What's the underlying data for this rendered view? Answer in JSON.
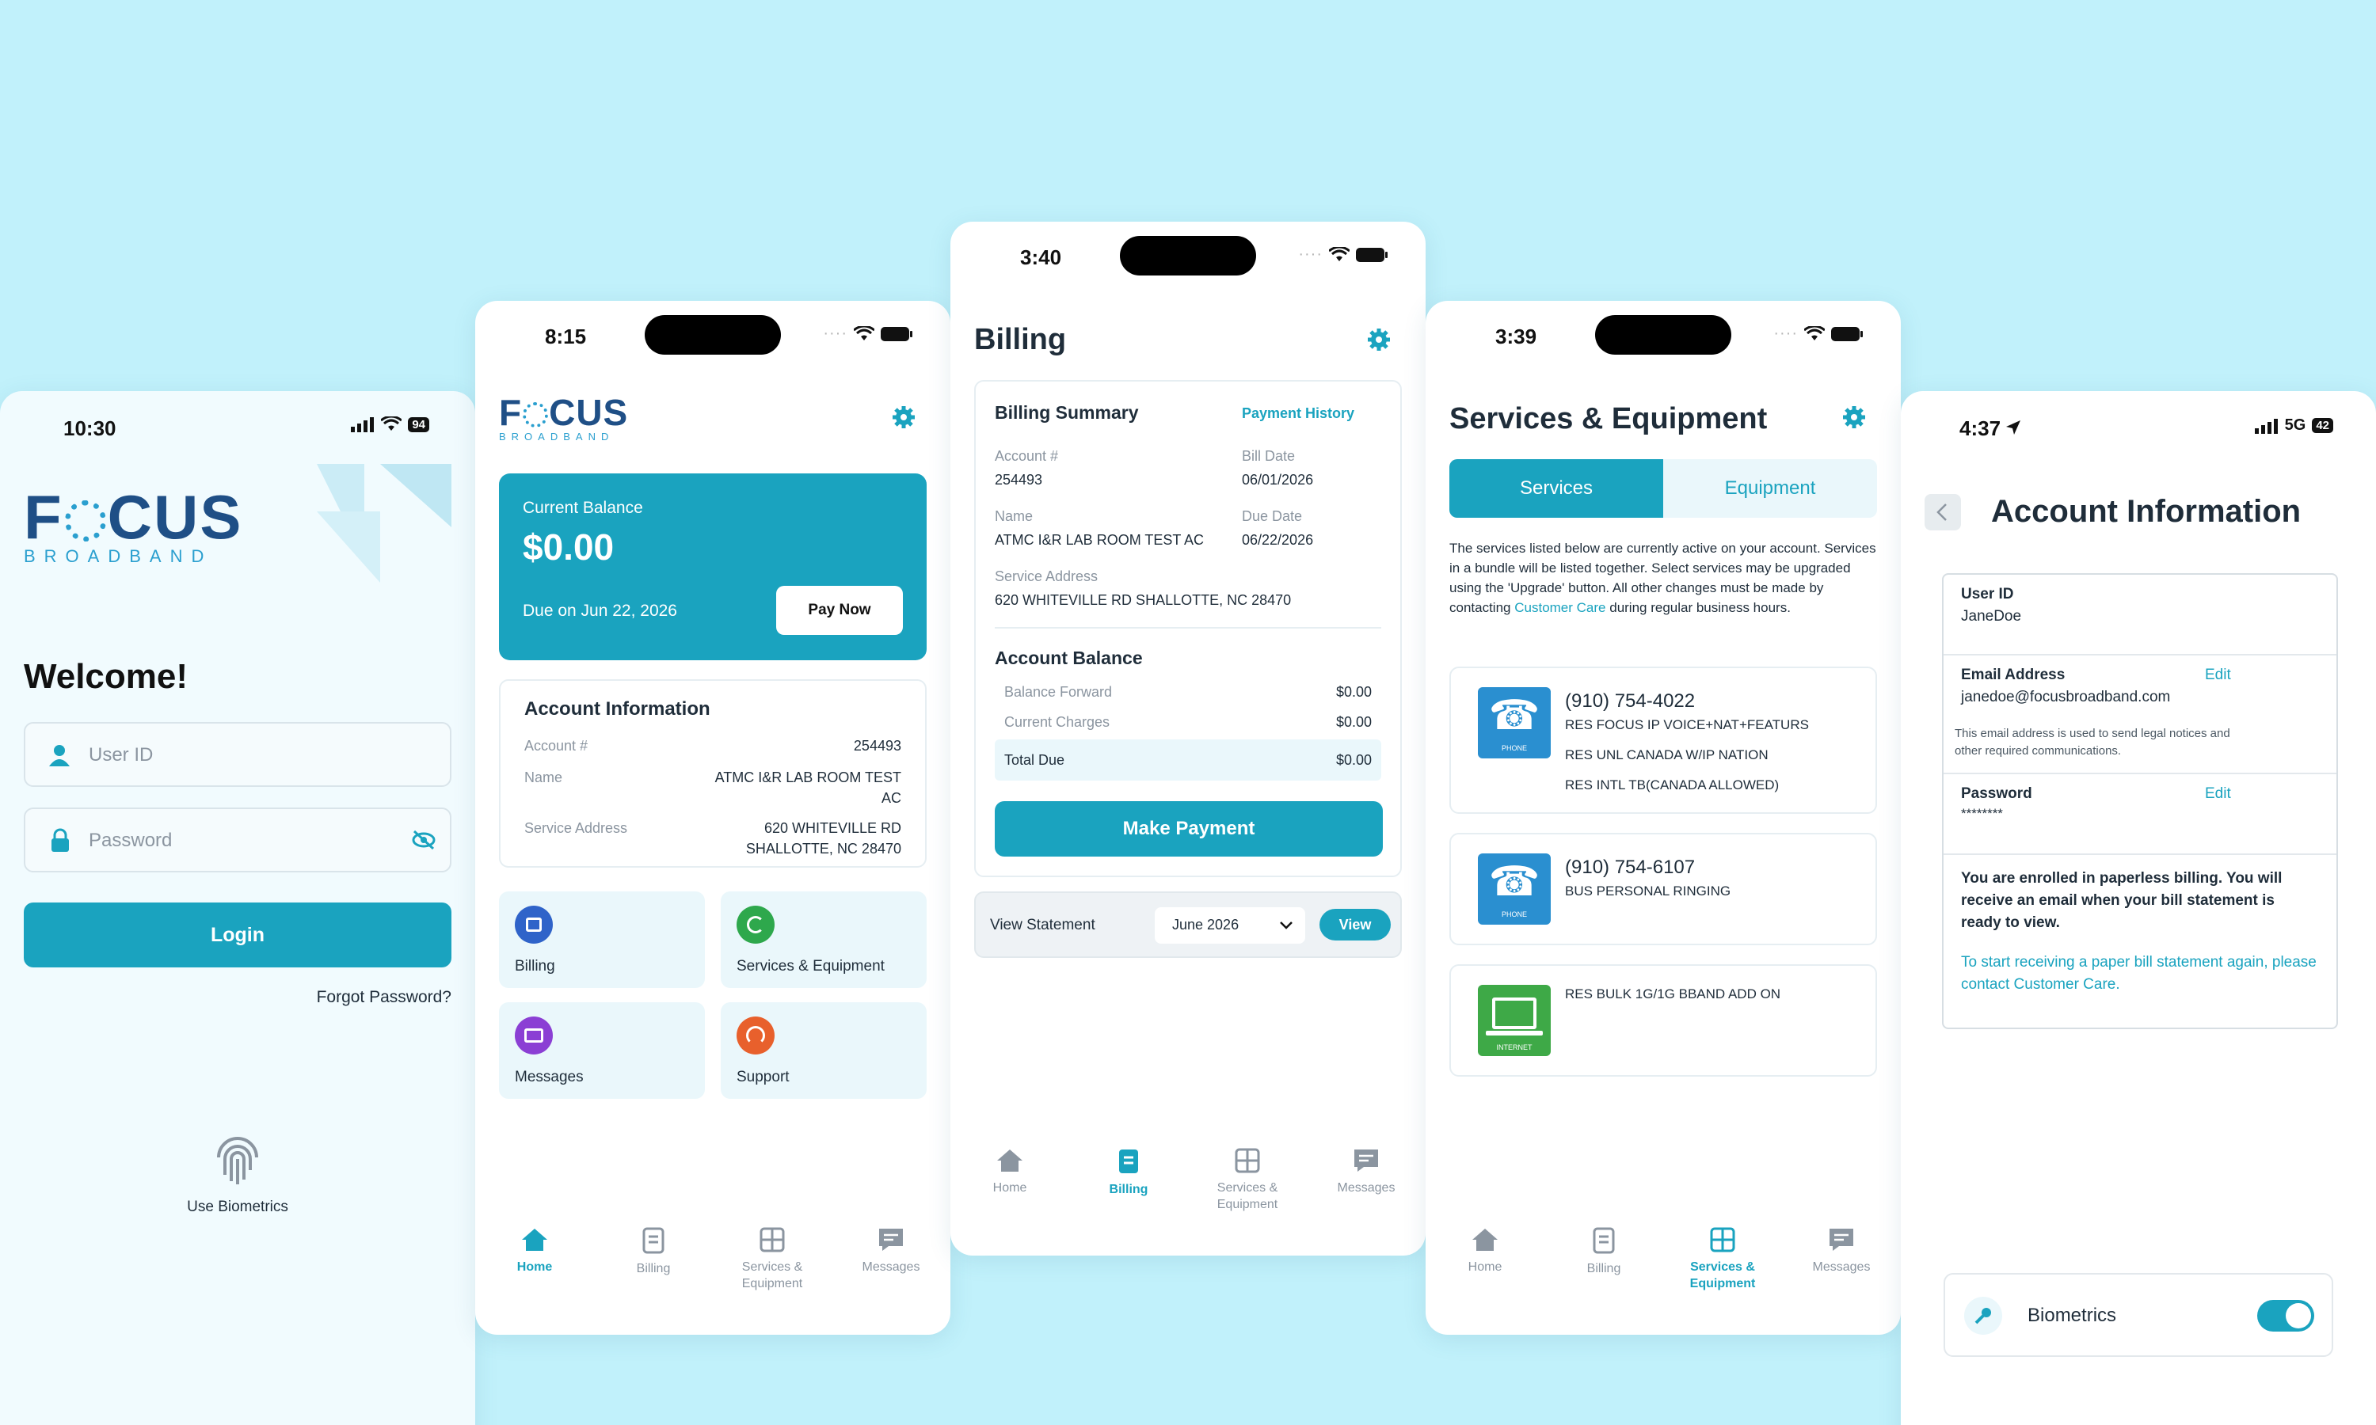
{
  "colors": {
    "accent": "#1aa3bf",
    "background": "#c1f1fb",
    "text": "#1f2d3a",
    "muted": "#8b95a0"
  },
  "login": {
    "time": "10:30",
    "battery": "94",
    "logo_main_a": "F",
    "logo_main_b": "CUS",
    "logo_sub": "BROADBAND",
    "welcome": "Welcome!",
    "userid_placeholder": "User ID",
    "password_placeholder": "Password",
    "login_button": "Login",
    "forgot": "Forgot Password?",
    "biometrics": "Use Biometrics"
  },
  "home": {
    "time": "8:15",
    "logo_main_a": "F",
    "logo_main_b": "CUS",
    "logo_sub": "BROADBAND",
    "balance_label": "Current Balance",
    "balance_value": "$0.00",
    "due": "Due on Jun 22, 2026",
    "pay_now": "Pay Now",
    "account_title": "Account Information",
    "account_rows": [
      {
        "label": "Account #",
        "value": "254493"
      },
      {
        "label": "Name",
        "value": "ATMC I&R LAB ROOM TEST",
        "value2": "AC"
      },
      {
        "label": "Service Address",
        "value": "620 WHITEVILLE RD",
        "value2": "SHALLOTTE, NC 28470"
      }
    ],
    "tiles": [
      {
        "label": "Billing",
        "icon": "billing-icon",
        "color": "#2f63c9"
      },
      {
        "label": "Services & Equipment",
        "icon": "refresh-icon",
        "color": "#2ea84c"
      },
      {
        "label": "Messages",
        "icon": "mail-icon",
        "color": "#8b3fd4"
      },
      {
        "label": "Support",
        "icon": "headset-icon",
        "color": "#e8602c"
      }
    ]
  },
  "billing": {
    "time": "3:40",
    "title": "Billing",
    "summary_title": "Billing Summary",
    "payment_history": "Payment History",
    "account_label": "Account #",
    "account_value": "254493",
    "bill_date_label": "Bill Date",
    "bill_date_value": "06/01/2026",
    "name_label": "Name",
    "name_value": "ATMC I&R LAB ROOM TEST AC",
    "due_date_label": "Due Date",
    "due_date_value": "06/22/2026",
    "service_address_label": "Service Address",
    "service_address_value": "620 WHITEVILLE RD SHALLOTTE, NC 28470",
    "balance_title": "Account Balance",
    "balance_rows": [
      {
        "label": "Balance Forward",
        "value": "$0.00"
      },
      {
        "label": "Current Charges",
        "value": "$0.00"
      },
      {
        "label": "Total Due",
        "value": "$0.00"
      }
    ],
    "make_payment": "Make Payment",
    "view_statement": "View Statement",
    "statement_month": "June 2026",
    "view": "View"
  },
  "services": {
    "time": "3:39",
    "title": "Services & Equipment",
    "tab_services": "Services",
    "tab_equipment": "Equipment",
    "desc_a": "The services listed below are currently active on your account. Services in a bundle will be listed together. Select services may be upgraded using the 'Upgrade' button. All other changes must be made by contacting",
    "desc_link": "Customer Care",
    "desc_b": "during regular business hours.",
    "items": [
      {
        "icon": "phone-icon",
        "icon_label": "PHONE",
        "number": "(910) 754-4022",
        "lines": [
          "RES FOCUS IP VOICE+NAT+FEATURS",
          "RES UNL CANADA W/IP NATION",
          "RES INTL TB(CANADA ALLOWED)"
        ]
      },
      {
        "icon": "phone-icon",
        "icon_label": "PHONE",
        "number": "(910) 754-6107",
        "lines": [
          "BUS PERSONAL RINGING"
        ]
      },
      {
        "icon": "internet-icon",
        "icon_label": "INTERNET",
        "number": "",
        "lines": [
          "RES BULK 1G/1G BBAND ADD ON"
        ]
      }
    ]
  },
  "account": {
    "time": "4:37",
    "network": "5G",
    "battery": "42",
    "title": "Account Information",
    "userid_label": "User ID",
    "userid_value": "JaneDoe",
    "email_label": "Email Address",
    "email_value": "janedoe@focusbroadband.com",
    "email_note": "This email address is used to send legal notices and other required communications.",
    "password_label": "Password",
    "password_value": "********",
    "edit": "Edit",
    "paperless_bold": "You are enrolled in paperless billing. You will receive an email when your bill statement is ready to view.",
    "paper_a": "To start receiving a paper bill statement again, please contact",
    "paper_link": "Customer Care.",
    "biometrics": "Biometrics",
    "biometrics_on": true
  },
  "nav": {
    "home": "Home",
    "billing": "Billing",
    "services_a": "Services &",
    "services_b": "Equipment",
    "messages": "Messages"
  }
}
